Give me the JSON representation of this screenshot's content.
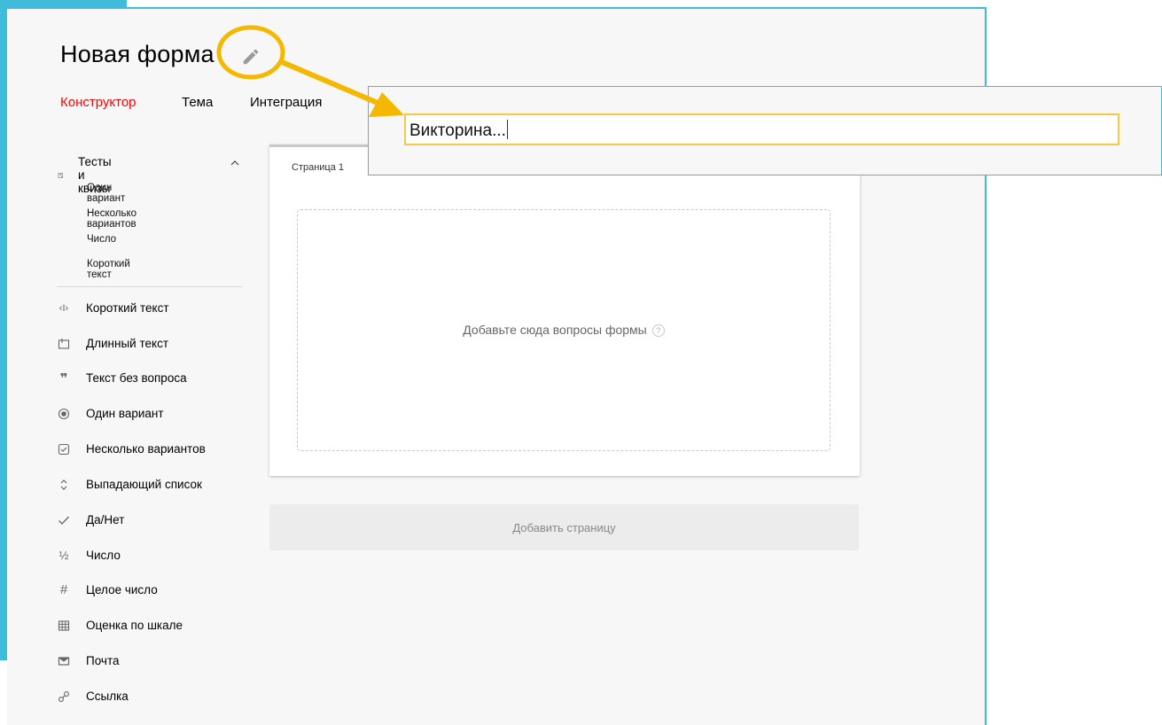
{
  "form": {
    "title": "Новая форма"
  },
  "tabs": [
    {
      "label": "Конструктор",
      "active": true
    },
    {
      "label": "Тема"
    },
    {
      "label": "Интеграция"
    }
  ],
  "sidebar": {
    "quiz_group": {
      "label": "Тесты и квизы",
      "expanded": true,
      "items": [
        "Один вариант",
        "Несколько вариантов",
        "Число",
        "Короткий текст"
      ]
    },
    "items": [
      {
        "label": "Короткий текст",
        "icon": "short-text-icon"
      },
      {
        "label": "Длинный текст",
        "icon": "long-text-icon"
      },
      {
        "label": "Текст без вопроса",
        "icon": "quote-icon"
      },
      {
        "label": "Один вариант",
        "icon": "radio-icon"
      },
      {
        "label": "Несколько вариантов",
        "icon": "checkbox-icon"
      },
      {
        "label": "Выпадающий список",
        "icon": "dropdown-icon"
      },
      {
        "label": "Да/Нет",
        "icon": "check-icon"
      },
      {
        "label": "Число",
        "icon": "fraction-icon"
      },
      {
        "label": "Целое число",
        "icon": "hash-icon"
      },
      {
        "label": "Оценка по шкале",
        "icon": "grid-icon"
      },
      {
        "label": "Почта",
        "icon": "mail-icon"
      },
      {
        "label": "Ссылка",
        "icon": "link-icon"
      }
    ]
  },
  "page": {
    "tab_label": "Страница 1",
    "empty_text": "Добавьте сюда вопросы формы",
    "help": "?"
  },
  "add_page_label": "Добавить страницу",
  "rename_popup": {
    "input_value": "Викторина..."
  },
  "colors": {
    "accent": "#3fbcd9",
    "highlight": "#f5b800",
    "active_tab": "#ff0000"
  }
}
